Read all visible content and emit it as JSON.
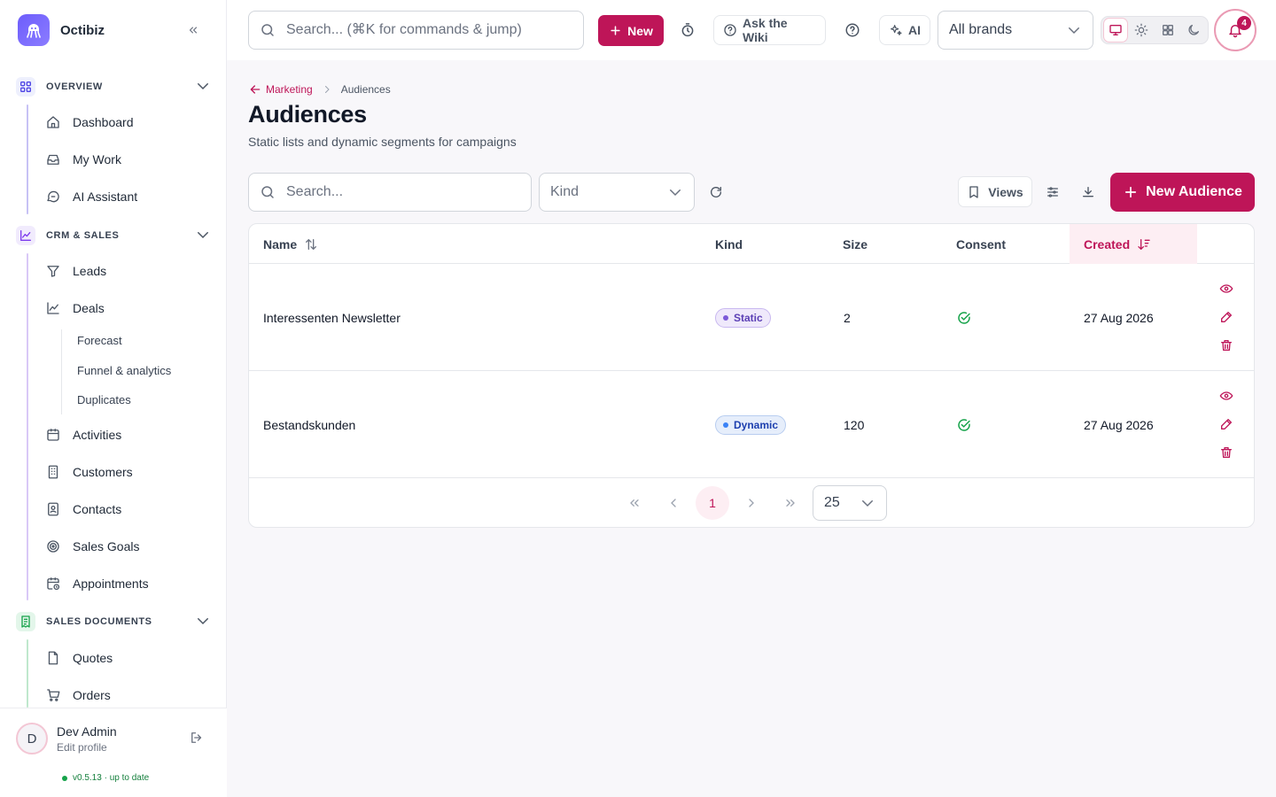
{
  "app": {
    "name": "Octibiz"
  },
  "sidebar": {
    "sections": [
      {
        "label": "OVERVIEW",
        "icon": "grid-icon",
        "items": [
          "Dashboard",
          "My Work",
          "AI Assistant"
        ]
      },
      {
        "label": "CRM & SALES",
        "icon": "chart-icon",
        "items": [
          "Leads",
          "Deals"
        ],
        "subitems": [
          "Forecast",
          "Funnel & analytics",
          "Duplicates"
        ],
        "items_after": [
          "Activities",
          "Customers",
          "Contacts",
          "Sales Goals",
          "Appointments"
        ]
      },
      {
        "label": "SALES DOCUMENTS",
        "icon": "receipt-icon",
        "items": [
          "Quotes",
          "Orders"
        ]
      }
    ],
    "profile": {
      "initial": "D",
      "name": "Dev Admin",
      "edit_label": "Edit profile"
    },
    "version": "v0.5.13 · up to date"
  },
  "topbar": {
    "search_placeholder": "Search... (⌘K for commands & jump)",
    "new_label": "New",
    "wiki_label": "Ask the Wiki",
    "ai_label": "AI",
    "brand_select": "All brands",
    "notification_count": "4"
  },
  "colors": {
    "accent": "#be1558",
    "accent_soft": "#fdeef3",
    "static_badge": "#7c5ad8",
    "dynamic_badge": "#3b82f6",
    "success": "#16a34a"
  },
  "page": {
    "breadcrumb_parent": "Marketing",
    "breadcrumb_current": "Audiences",
    "title": "Audiences",
    "subtitle": "Static lists and dynamic segments for campaigns"
  },
  "toolbar": {
    "search_placeholder": "Search...",
    "kind_placeholder": "Kind",
    "views_label": "Views",
    "new_audience_label": "New Audience"
  },
  "table": {
    "columns": {
      "name": "Name",
      "kind": "Kind",
      "size": "Size",
      "consent": "Consent",
      "created": "Created"
    },
    "sort_column": "Created",
    "rows": [
      {
        "name": "Interessenten Newsletter",
        "kind": "Static",
        "size": "2",
        "consent": true,
        "created": "27 Aug 2026"
      },
      {
        "name": "Bestandskunden",
        "kind": "Dynamic",
        "size": "120",
        "consent": true,
        "created": "27 Aug 2026"
      }
    ]
  },
  "pagination": {
    "current_page": "1",
    "page_size": "25"
  }
}
